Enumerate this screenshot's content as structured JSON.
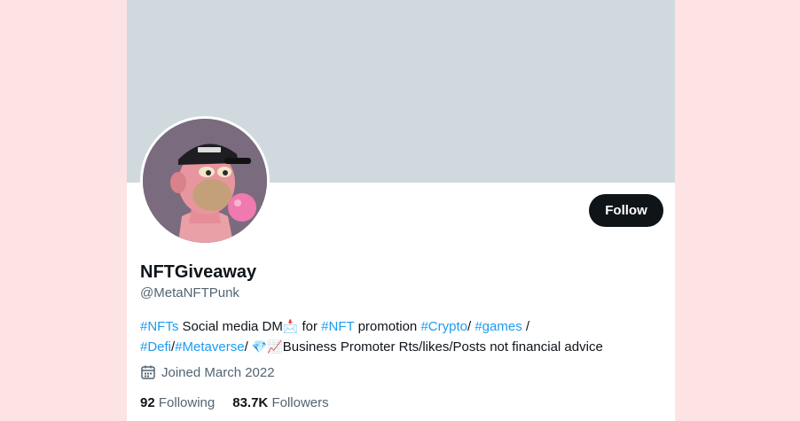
{
  "profile": {
    "display_name": "NFTGiveaway",
    "handle": "@MetaNFTPunk",
    "follow_label": "Follow",
    "bio": {
      "t1": "#NFTs",
      "t2": " Social media DM",
      "e1": "📩",
      "t3": " for ",
      "t4": "#NFT",
      "t5": " promotion ",
      "t6": "#Crypto",
      "t7": "/ ",
      "t8": "#games",
      "t9": " /",
      "t10": "#Defi",
      "t11": "/",
      "t12": "#Metaverse",
      "t13": "/ ",
      "e2": "💎",
      "e3": "📈",
      "t14": "Business Promoter Rts/likes/Posts not financial advice"
    },
    "joined": "Joined March 2022",
    "following_count": "92",
    "following_label": "Following",
    "followers_count": "83.7K",
    "followers_label": "Followers"
  },
  "icons": {
    "calendar": "calendar-icon"
  },
  "colors": {
    "page_bg": "#fde3e3",
    "banner": "#cfd9de",
    "link": "#1d9bf0",
    "button_bg": "#0f1419",
    "secondary_text": "#536471"
  }
}
